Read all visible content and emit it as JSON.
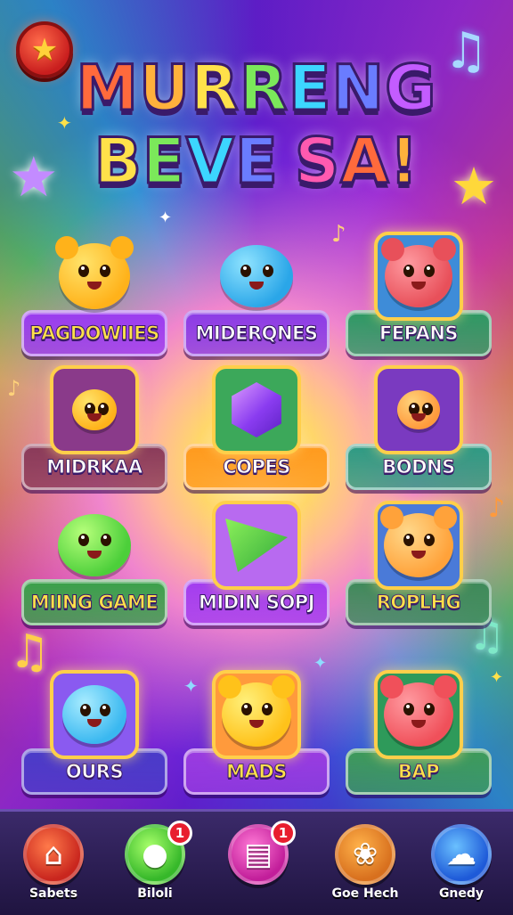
{
  "header": {
    "title_line1_letters": [
      "M",
      "U",
      "R",
      "R",
      "E",
      "N",
      "G"
    ],
    "title_line2_letters": [
      "B",
      "E",
      "V",
      "E",
      " ",
      "S",
      "A",
      "!"
    ],
    "title_colors": [
      "#ff6a3c",
      "#ffb13c",
      "#ffe14a",
      "#7be85a",
      "#3cd6ff",
      "#6a7cff",
      "#c35cff",
      "#ff5ab0"
    ],
    "back_icon": "star-icon"
  },
  "tiles": [
    {
      "label": "PAGDOWIIES",
      "plate": "#9b3cf0",
      "label_color": "yellow",
      "icon": "yellow-bear-icon"
    },
    {
      "label": "MIDERQNES",
      "plate": "#8b3ce6",
      "label_color": "white",
      "icon": "blue-blob-icon"
    },
    {
      "label": "FEPANS",
      "plate": "#2e9a64",
      "label_color": "white",
      "icon": "red-bunny-icon"
    },
    {
      "label": "MIDRKAA",
      "plate": "#8a3a5a",
      "label_color": "white",
      "icon": "character-group-icon"
    },
    {
      "label": "COPES",
      "plate": "#ff9a1e",
      "label_color": "white",
      "icon": "purple-gem-icon"
    },
    {
      "label": "BODNS",
      "plate": "#2e9a84",
      "label_color": "white",
      "icon": "candy-group-icon"
    },
    {
      "label": "MIING GAME",
      "plate": "#3aa14a",
      "label_color": "yellow",
      "icon": "green-frog-icon"
    },
    {
      "label": "MIDIN SOPJ",
      "plate": "#a23cf0",
      "label_color": "white",
      "icon": "green-slice-icon"
    },
    {
      "label": "ROPLHG",
      "plate": "#3e8a5a",
      "label_color": "yellow",
      "icon": "orange-bear-icon"
    },
    {
      "label": "OURS",
      "plate": "#4a3cc8",
      "label_color": "white",
      "icon": "blue-fish-icon"
    },
    {
      "label": "MADS",
      "plate": "#9a3ce0",
      "label_color": "yellow",
      "icon": "yellow-cat-icon"
    },
    {
      "label": "BAP",
      "plate": "#3e9a5a",
      "label_color": "yellow",
      "icon": "red-bear-icon"
    }
  ],
  "nav": [
    {
      "label": "Sabets",
      "icon": "home-icon",
      "badge": ""
    },
    {
      "label": "Biloli",
      "icon": "green-critter-icon",
      "badge": "1"
    },
    {
      "label": "",
      "icon": "map-card-icon",
      "badge": "1"
    },
    {
      "label": "Goe Hech",
      "icon": "puzzle-icon",
      "badge": ""
    },
    {
      "label": "Gnedy",
      "icon": "cloud-icon",
      "badge": ""
    }
  ]
}
